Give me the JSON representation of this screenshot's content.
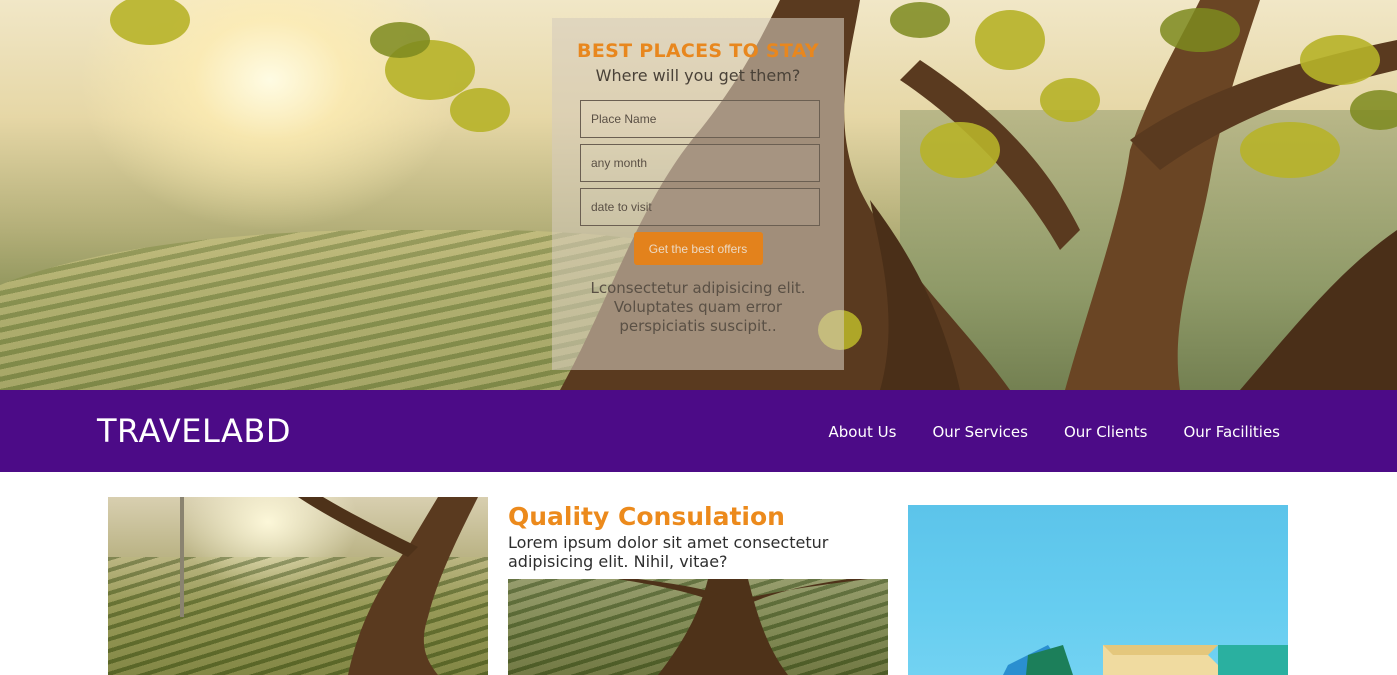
{
  "hero": {
    "heading": "BEST PLACES TO STAY",
    "subheading": "Where will you get them?",
    "inputs": [
      {
        "placeholder": "Place Name"
      },
      {
        "placeholder": "any month"
      },
      {
        "placeholder": "date to visit"
      }
    ],
    "button_label": "Get the best offers",
    "description": "Lconsectetur adipisicing elit. Voluptates quam error perspiciatis suscipit.."
  },
  "navbar": {
    "brand": "TRAVELABD",
    "links": [
      "About Us",
      "Our Services",
      "Our Clients",
      "Our Facilities"
    ],
    "background": "#4c0b87"
  },
  "feature": {
    "title": "Quality Consulation",
    "text": "Lorem ipsum dolor sit amet consectetur adipisicing elit. Nihil, vitae?"
  },
  "colors": {
    "accent": "#e8871e",
    "nav": "#4c0b87"
  }
}
